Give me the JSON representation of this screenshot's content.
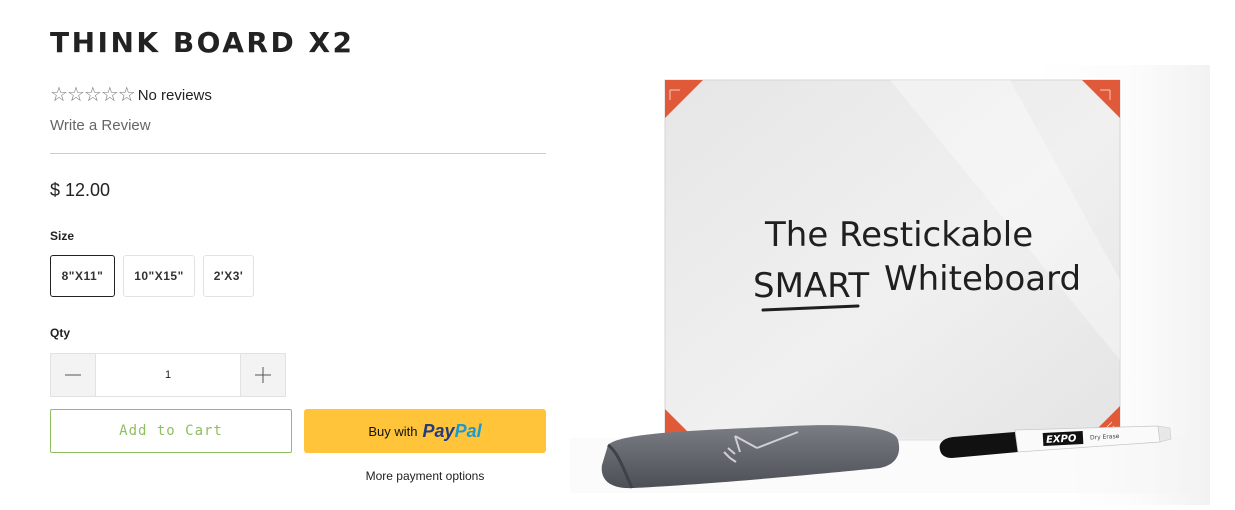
{
  "product": {
    "title": "THINK BOARD X2",
    "rating_stars": 5,
    "rating_value": 0,
    "reviews_text": "No reviews",
    "write_review": "Write a Review",
    "price": "$ 12.00"
  },
  "size": {
    "label": "Size",
    "options": [
      "8\"X11\"",
      "10\"X15\"",
      "2'X3'"
    ],
    "selected": "8\"X11\""
  },
  "quantity": {
    "label": "Qty",
    "value": "1"
  },
  "buttons": {
    "add_to_cart": "Add to Cart",
    "paypal_prefix": "Buy with",
    "paypal_pay": "Pay",
    "paypal_pal": "Pal",
    "more_payment_options": "More payment options"
  },
  "image": {
    "line1": "The Restickable",
    "line2_emphasis": "SMART",
    "line2_rest": "Whiteboard",
    "marker_brand": "EXPO",
    "marker_subtext": "Dry Erase"
  },
  "colors": {
    "add_to_cart_accent": "#8dc060",
    "paypal_button": "#ffc439",
    "corner_accent": "#e05a3a",
    "cloth": "#5f6368"
  }
}
